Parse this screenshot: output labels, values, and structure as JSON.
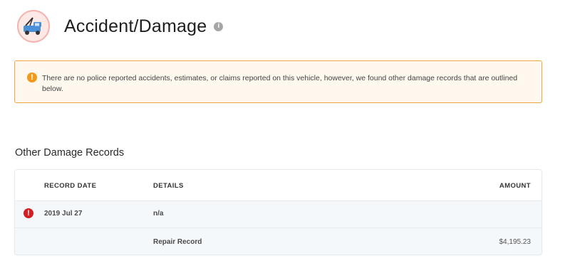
{
  "header": {
    "title": "Accident/Damage",
    "logo_icon": "tow-truck-icon",
    "info_icon": "info-icon"
  },
  "alert": {
    "icon": "warning-icon",
    "text": "There are no police reported accidents, estimates, or claims reported on this vehicle, however, we found other damage records that are outlined below."
  },
  "records": {
    "section_title": "Other Damage Records",
    "columns": [
      "RECORD DATE",
      "DETAILS",
      "AMOUNT"
    ],
    "rows": [
      {
        "icon": "error-icon",
        "date": "2019 Jul 27",
        "details": "n/a",
        "amount": ""
      },
      {
        "icon": "",
        "date": "",
        "details": "Repair Record",
        "amount": "$4,195.23"
      }
    ]
  },
  "colors": {
    "alert_border": "#f1a640",
    "alert_background": "#fff8ef",
    "warning_icon": "#f19a1a",
    "error_icon": "#d21f26",
    "row_background": "#f5f8fb"
  }
}
